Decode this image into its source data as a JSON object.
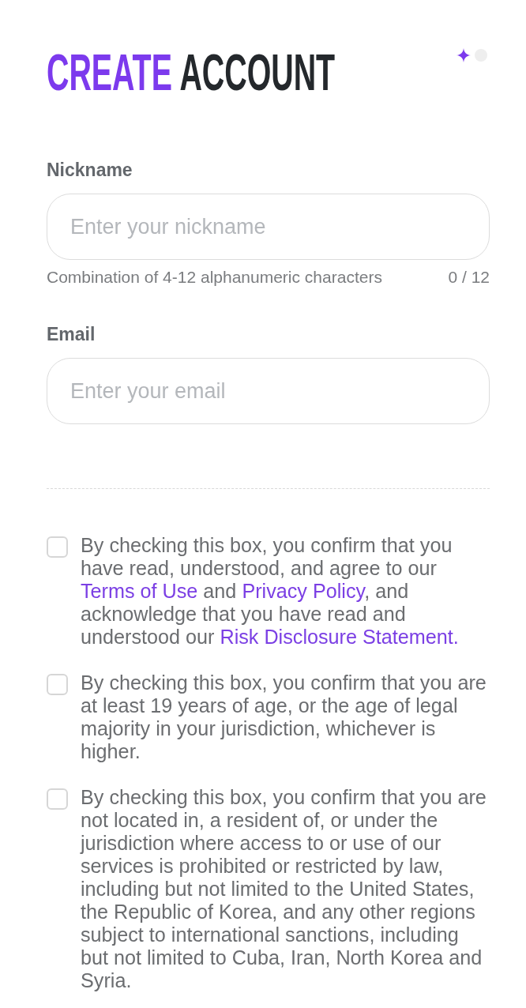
{
  "header": {
    "title_accent": "CREATE",
    "title": "ACCOUNT",
    "steps": [
      {
        "selected": true
      },
      {
        "selected": false
      }
    ]
  },
  "fields": [
    {
      "label": "Nickname",
      "placeholder": "Enter your nickname",
      "hint": "Combination of 4-12 alphanumeric characters",
      "counter": "0 / 12"
    },
    {
      "label": "Email",
      "placeholder": "Enter your email"
    }
  ],
  "agreements": [
    {
      "checked": false,
      "parts": [
        {
          "text": "By checking this box, you confirm that you have read, understood, and agree to our ",
          "link": false
        },
        {
          "text": "Terms of Use",
          "link": true
        },
        {
          "text": " and ",
          "link": false
        },
        {
          "text": "Privacy Policy",
          "link": true
        },
        {
          "text": ", and acknowledge that you have read and understood our ",
          "link": false
        },
        {
          "text": "Risk Disclosure Statement.",
          "link": true
        }
      ]
    },
    {
      "checked": false,
      "parts": [
        {
          "text": "By checking this box, you confirm that you are at least 19 years of age, or the age of legal majority in your jurisdiction, whichever is higher.",
          "link": false
        }
      ]
    },
    {
      "checked": false,
      "parts": [
        {
          "text": "By checking this box, you confirm that you are not located in, a resident of, or under the jurisdiction where access to or use of our services is prohibited or restricted by law, including but not limited to the United States, the Republic of Korea, and any other regions subject to international sanctions, including but not limited to Cuba, Iran, North Korea and Syria.",
          "link": false
        }
      ]
    }
  ]
}
